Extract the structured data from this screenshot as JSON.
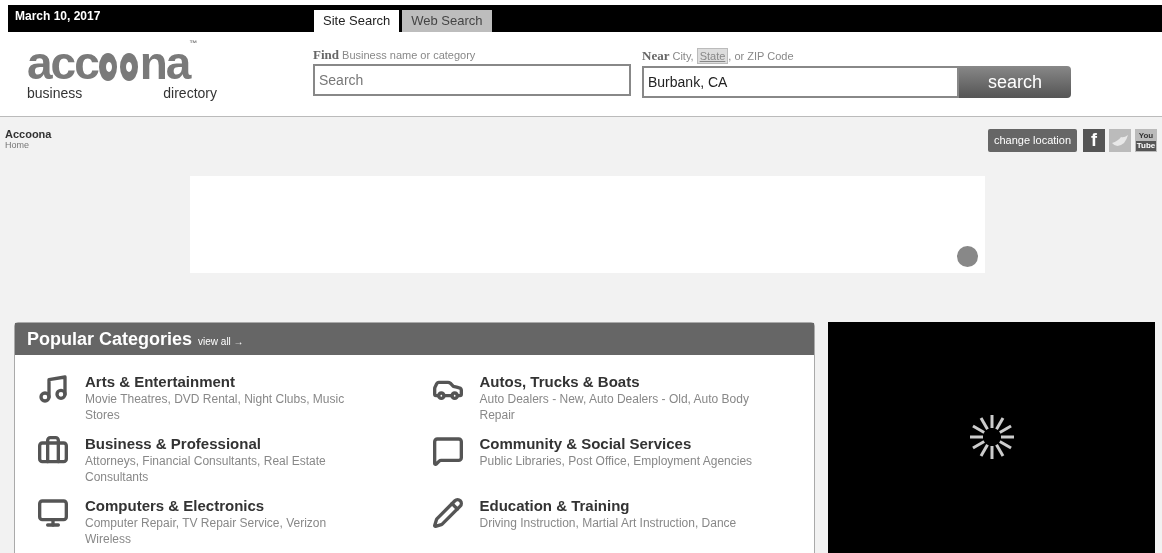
{
  "top_bar": {
    "date": "March 10, 2017",
    "tabs": [
      {
        "label": "Site Search",
        "selected": true
      },
      {
        "label": "Web Search",
        "selected": false
      }
    ]
  },
  "logo": {
    "wordmark_left": "acc",
    "wordmark_right": "na",
    "trademark": "™",
    "tagline_left": "business",
    "tagline_right": "directory"
  },
  "find": {
    "label": "Find",
    "hint": "Business name or category",
    "placeholder": "Search"
  },
  "near": {
    "label": "Near",
    "hint_before": "City,",
    "state_tag": "State",
    "hint_after": ", or ZIP Code",
    "value": "Burbank, CA"
  },
  "search_button": "search",
  "breadcrumb": {
    "title": "Accoona",
    "link": "Home"
  },
  "change_location": "change location",
  "social": {
    "facebook": "f",
    "youtube_top": "You",
    "youtube_bottom": "Tube"
  },
  "popular": {
    "title": "Popular Categories",
    "view_all": "view all →",
    "categories": [
      {
        "kind": "music",
        "name": "Arts & Entertainment",
        "examples": "Movie Theatres, DVD Rental, Night Clubs, Music Stores"
      },
      {
        "kind": "car",
        "name": "Autos, Trucks & Boats",
        "examples": "Auto Dealers - New, Auto Dealers - Old, Auto Body Repair"
      },
      {
        "kind": "briefcase",
        "name": "Business & Professional",
        "examples": "Attorneys, Financial Consultants, Real Estate Consultants"
      },
      {
        "kind": "chat",
        "name": "Community & Social Services",
        "examples": "Public Libraries, Post Office, Employment Agencies"
      },
      {
        "kind": "monitor",
        "name": "Computers & Electronics",
        "examples": "Computer Repair, TV Repair Service, Verizon Wireless"
      },
      {
        "kind": "pencil",
        "name": "Education & Training",
        "examples": "Driving Instruction, Martial Art Instruction, Dance"
      }
    ]
  }
}
